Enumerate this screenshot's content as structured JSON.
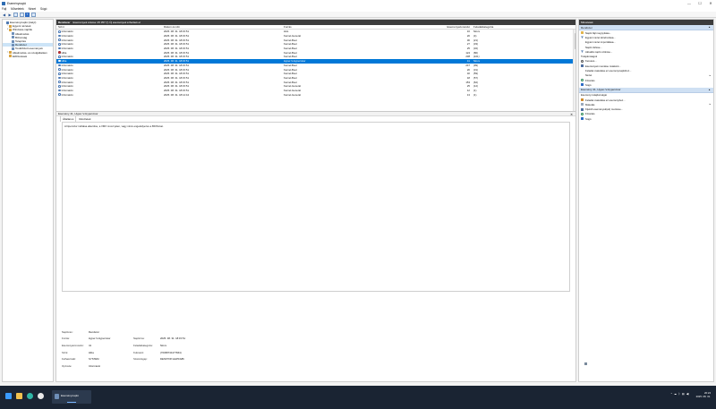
{
  "window": {
    "title": "Eseménynapló",
    "min": "—",
    "max": "☐",
    "close": "✕"
  },
  "menu": [
    "Fájl",
    "Műveletek",
    "Nézet",
    "Súgó"
  ],
  "tree": {
    "items": [
      {
        "label": "Eseménynapló (Helyi)",
        "indent": 0,
        "exp": "",
        "type": "pc"
      },
      {
        "label": "Egyéni nézetek",
        "indent": 1,
        "exp": ">",
        "type": "folder"
      },
      {
        "label": "Windows-naplók",
        "indent": 1,
        "exp": "v",
        "type": "folder"
      },
      {
        "label": "Alkalmazás",
        "indent": 2,
        "exp": "",
        "type": "log"
      },
      {
        "label": "Biztonság",
        "indent": 2,
        "exp": "",
        "type": "log"
      },
      {
        "label": "Telepítés",
        "indent": 2,
        "exp": "",
        "type": "log"
      },
      {
        "label": "Rendszer",
        "indent": 2,
        "exp": "",
        "type": "log",
        "selected": true
      },
      {
        "label": "Továbbított események",
        "indent": 2,
        "exp": "",
        "type": "log"
      },
      {
        "label": "Alkalmazás- és szolgáltatásn",
        "indent": 1,
        "exp": ">",
        "type": "folder"
      },
      {
        "label": "Előfizetések",
        "indent": 1,
        "exp": "",
        "type": "folder"
      }
    ]
  },
  "center": {
    "log_name": "Rendszer",
    "summary": "Események száma: 25 357 (!) Új események érhetőek el",
    "columns": {
      "level": "Szint",
      "date": "Dátum és idő",
      "source": "Forrás",
      "id": "Eseményazonosító",
      "category": "Feladatkategória"
    },
    "rows": [
      {
        "level": "Információ",
        "date": "2025. 08. 31. 18:15:51",
        "source": "HAL",
        "id": "16",
        "category": "Nincs",
        "err": false
      },
      {
        "level": "Információ",
        "date": "2025. 08. 31. 18:15:51",
        "source": "Kernel-General",
        "id": "20",
        "category": "(4)",
        "err": false
      },
      {
        "level": "Információ",
        "date": "2025. 08. 31. 18:15:51",
        "source": "Kernel-Boot",
        "id": "30",
        "category": "(21)",
        "err": false
      },
      {
        "level": "Információ",
        "date": "2025. 08. 31. 18:15:51",
        "source": "Kernel-Boot",
        "id": "27",
        "category": "(33)",
        "err": false
      },
      {
        "level": "Információ",
        "date": "2025. 08. 31. 18:15:51",
        "source": "Kernel-Boot",
        "id": "25",
        "category": "(32)",
        "err": false
      },
      {
        "level": "Hiba",
        "date": "2025. 08. 31. 18:15:51",
        "source": "Kernel-Boot",
        "id": "124",
        "category": "(80)",
        "err": true
      },
      {
        "level": "Információ",
        "date": "2025. 08. 31. 18:15:51",
        "source": "Kernel-Boot",
        "id": "238",
        "category": "(101)",
        "err": false
      },
      {
        "level": "Hiba",
        "date": "2025. 08. 31. 18:15:51",
        "source": "Hyper-V-Hypervisor",
        "id": "41",
        "category": "Nincs",
        "err": true,
        "selected": true
      },
      {
        "level": "Információ",
        "date": "2025. 08. 31. 18:15:51",
        "source": "Kernel-Boot",
        "id": "247",
        "category": "(99)",
        "err": false
      },
      {
        "level": "Információ",
        "date": "2025. 08. 31. 18:15:51",
        "source": "Kernel-Boot",
        "id": "20",
        "category": "(31)",
        "err": false
      },
      {
        "level": "Információ",
        "date": "2025. 08. 31. 18:15:51",
        "source": "Kernel-Boot",
        "id": "32",
        "category": "(59)",
        "err": false
      },
      {
        "level": "Információ",
        "date": "2025. 08. 31. 18:15:51",
        "source": "Kernel-Boot",
        "id": "18",
        "category": "(57)",
        "err": false
      },
      {
        "level": "Információ",
        "date": "2025. 08. 31. 18:15:51",
        "source": "Kernel-Boot",
        "id": "153",
        "category": "(62)",
        "err": false
      },
      {
        "level": "Információ",
        "date": "2025. 08. 31. 18:15:51",
        "source": "Kernel-General",
        "id": "25",
        "category": "(12)",
        "err": false
      },
      {
        "level": "Információ",
        "date": "2025. 08. 31. 18:15:51",
        "source": "Kernel-General",
        "id": "12",
        "category": "(1)",
        "err": false
      },
      {
        "level": "Információ",
        "date": "2025. 08. 31. 18:14:44",
        "source": "Kernel-General",
        "id": "13",
        "category": "(1)",
        "err": false
      }
    ],
    "detail": {
      "header": "Esemény 41, Hyper-V-Hypervisor",
      "close": "✕",
      "tabs": [
        "Általános",
        "Részletek"
      ],
      "description": "A hipervizor indítása elkerülve, a VMX mnozi jelen, vagy nincs engedélyezve a BIOS-ban.",
      "props": [
        {
          "k1": "Naplónév:",
          "v1": "Rendszer",
          "k2": "",
          "v2": ""
        },
        {
          "k1": "Forrás:",
          "v1": "Hyper-V-Hypervisor",
          "k2": "Naplózva:",
          "v2": "2025. 08. 31. 18:15:51"
        },
        {
          "k1": "Eseményazonosító:",
          "v1": "41",
          "k2": "Feladatkategória:",
          "v2": "Nincs"
        },
        {
          "k1": "Szint:",
          "v1": "Hiba",
          "k2": "Kulcsszó:",
          "v2": "(70368744177664)"
        },
        {
          "k1": "Felhasználó:",
          "v1": "SYSTEM",
          "k2": "Számítógép:",
          "v2": "DESKTOP-HHPFA86"
        },
        {
          "k1": "OpCode:",
          "v1": "Információ",
          "k2": "",
          "v2": ""
        }
      ]
    }
  },
  "actions": {
    "title": "Műveletek",
    "section1": "Rendszer",
    "items1": [
      {
        "label": "Napló fájl megnyitása...",
        "icon": "folder"
      },
      {
        "label": "Egyéni nézet létrehozása...",
        "icon": "filter"
      },
      {
        "label": "Egyéni nézet importálása...",
        "icon": "none"
      },
      {
        "label": "Napló törlése...",
        "icon": "none"
      },
      {
        "label": "Aktuális napló szűrése...",
        "icon": "filter"
      },
      {
        "label": "Tulajdonságok",
        "icon": "props"
      },
      {
        "label": "Keresés...",
        "icon": "find"
      },
      {
        "label": "Események mentése másként...",
        "icon": "save"
      },
      {
        "label": "Feladat csatolása ez eseménynaplóhoz...",
        "icon": "none"
      },
      {
        "label": "Nézet",
        "icon": "none",
        "sub": "▸"
      },
      {
        "label": "Frissítés",
        "icon": "refresh"
      },
      {
        "label": "Súgó",
        "icon": "help"
      }
    ],
    "section2": "Esemény 41, Hyper-V-Hypervisor",
    "items2": [
      {
        "label": "Esemény tulajdonságai",
        "icon": "props"
      },
      {
        "label": "Feladat csatolása ez eseményhez...",
        "icon": "task"
      },
      {
        "label": "Másolás",
        "icon": "copy",
        "sub": "▸"
      },
      {
        "label": "Kijelölt események(ek) mentése...",
        "icon": "save"
      },
      {
        "label": "Frissítés",
        "icon": "refresh"
      },
      {
        "label": "Súgó",
        "icon": "help"
      }
    ]
  },
  "taskbar": {
    "app_label": "Eseménynapló",
    "time": "20:24",
    "date": "2025. 08. 31."
  }
}
